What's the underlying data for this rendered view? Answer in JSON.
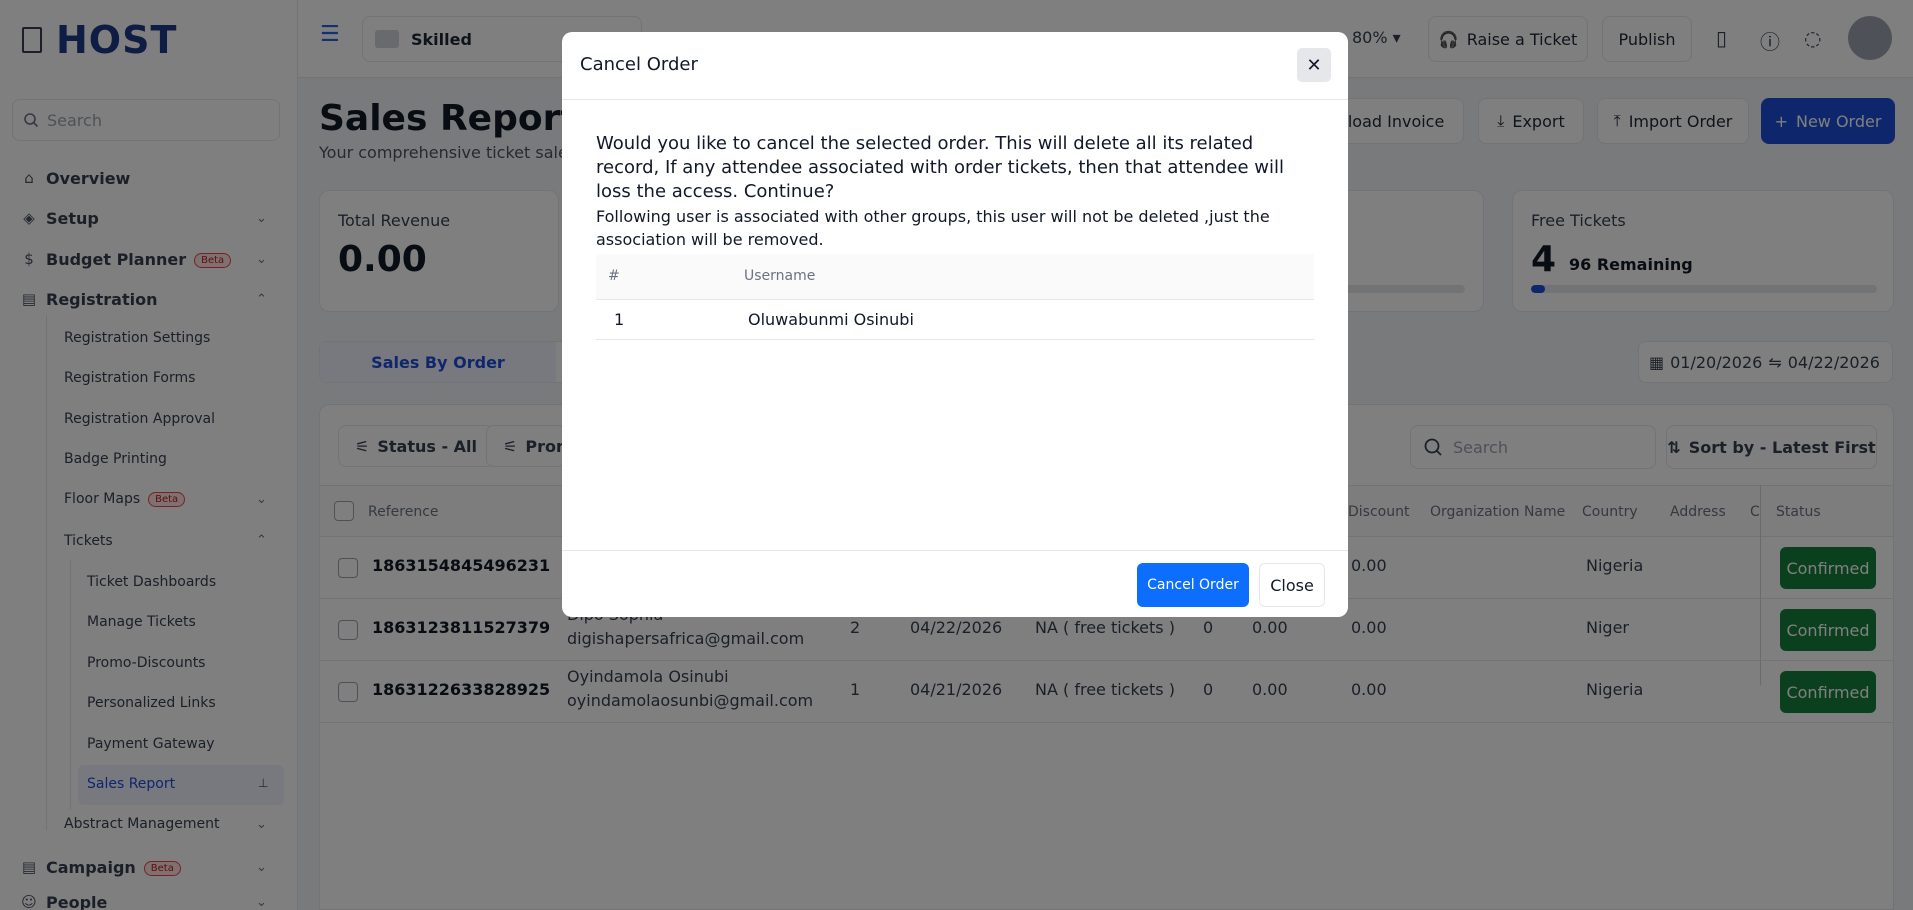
{
  "sidebar": {
    "logo": "HOST",
    "search_placeholder": "Search",
    "items": [
      {
        "label": "Overview"
      },
      {
        "label": "Setup"
      },
      {
        "label": "Budget Planner",
        "badge": "Beta"
      },
      {
        "label": "Registration"
      }
    ],
    "registration_sub": [
      "Registration Settings",
      "Registration Forms",
      "Registration Approval",
      "Badge Printing",
      "Floor Maps",
      "Tickets"
    ],
    "floor_maps_badge": "Beta",
    "tickets_sub": [
      "Ticket Dashboards",
      "Manage Tickets",
      "Promo-Discounts",
      "Personalized Links",
      "Payment Gateway",
      "Sales Report"
    ],
    "abstract_management": "Abstract Management",
    "campaign": "Campaign",
    "campaign_badge": "Beta",
    "people": "People"
  },
  "topbar": {
    "event_name": "Skilled",
    "zoom": "80%",
    "raise_ticket": "Raise a Ticket",
    "publish": "Publish"
  },
  "header": {
    "title": "Sales Report",
    "subtitle": "Your comprehensive ticket sales",
    "download_invoice": "nload Invoice",
    "export": "Export",
    "import_order": "Import Order",
    "new_order": "New Order"
  },
  "cards": {
    "total_revenue_label": "Total Revenue",
    "total_revenue_value": "0.00",
    "free_tickets_label": "Free Tickets",
    "free_tickets_value": "4",
    "free_tickets_remaining": "96 Remaining",
    "free_tickets_progress": 0.04
  },
  "tabs": {
    "active": "Sales By Order"
  },
  "date_range": {
    "start": "01/20/2026",
    "end": "04/22/2026"
  },
  "filters": {
    "status": "Status - All",
    "promo": "Prom",
    "search_placeholder": "Search",
    "sort": "Sort by - Latest First"
  },
  "table": {
    "headers": {
      "reference": "Reference",
      "discount": "Discount",
      "organization": "Organization Name",
      "country": "Country",
      "address": "Address",
      "c": "C",
      "status": "Status"
    },
    "rows": [
      {
        "reference": "1863154845496231",
        "name": "",
        "email": "",
        "qty": "",
        "date": "",
        "ticket": "",
        "n": "",
        "amount": "",
        "discount": "0.00",
        "country": "Nigeria",
        "status": "Confirmed"
      },
      {
        "reference": "1863123811527379",
        "name": "Dipo Sophia",
        "email": "digishapersafrica@gmail.com",
        "qty": "2",
        "date": "04/22/2026",
        "ticket": "NA ( free tickets )",
        "n": "0",
        "amount": "0.00",
        "discount": "0.00",
        "country": "Niger",
        "status": "Confirmed"
      },
      {
        "reference": "1863122633828925",
        "name": "Oyindamola Osinubi",
        "email": "oyindamolaosunbi@gmail.com",
        "qty": "1",
        "date": "04/21/2026",
        "ticket": "NA ( free tickets )",
        "n": "0",
        "amount": "0.00",
        "discount": "0.00",
        "country": "Nigeria",
        "status": "Confirmed"
      }
    ]
  },
  "modal": {
    "title": "Cancel Order",
    "message": "Would you like to cancel the selected order. This will delete all its related record, If any attendee associated with order tickets, then that attendee will loss the access. Continue?",
    "note": "Following user is associated with other groups, this user will not be deleted ,just the association will be removed.",
    "col_num": "#",
    "col_username": "Username",
    "users": [
      {
        "num": "1",
        "username": "Oluwabunmi Osinubi"
      }
    ],
    "confirm_label": "Cancel Order",
    "close_label": "Close"
  },
  "colors": {
    "primary": "#1d4ed8",
    "confirm": "#0d6efd",
    "status_confirmed": "#15803d",
    "beta": "#ef4444"
  }
}
